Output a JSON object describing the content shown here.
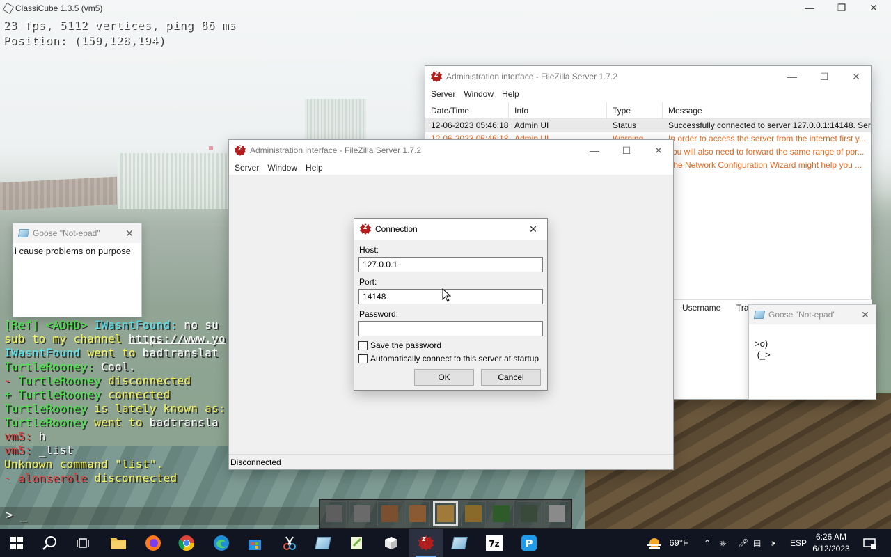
{
  "game": {
    "window_title": "ClassiCube 1.3.5 (vm5)",
    "hud_line1": "23 fps, 5112 vertices, ping 86 ms",
    "hud_line2": "Position: (159,128,194)",
    "chat": [
      [
        {
          "t": "[Ref] <ADHD> ",
          "c": "green"
        },
        {
          "t": "IWasntFound: ",
          "c": "cyan"
        },
        {
          "t": "no su",
          "c": "white"
        }
      ],
      [
        {
          "t": "sub to my channel ",
          "c": "yellow"
        },
        {
          "t": "https://www.yo",
          "c": "link"
        }
      ],
      [
        {
          "t": "IWasntFound",
          "c": "cyan"
        },
        {
          "t": " went to ",
          "c": "yellow"
        },
        {
          "t": "badtranslat",
          "c": "white"
        }
      ],
      [
        {
          "t": "TurtleRooney: ",
          "c": "green"
        },
        {
          "t": "Cool.",
          "c": "white"
        }
      ],
      [
        {
          "t": "- ",
          "c": "red"
        },
        {
          "t": "TurtleRooney",
          "c": "green"
        },
        {
          "t": " disconnected",
          "c": "yellow"
        }
      ],
      [
        {
          "t": "+ ",
          "c": "green"
        },
        {
          "t": "TurtleRooney",
          "c": "green"
        },
        {
          "t": " connected",
          "c": "yellow"
        }
      ],
      [
        {
          "t": "TurtleRooney",
          "c": "green"
        },
        {
          "t": " is lately known as:",
          "c": "yellow"
        }
      ],
      [
        {
          "t": "TurtleRooney",
          "c": "green"
        },
        {
          "t": " went to ",
          "c": "yellow"
        },
        {
          "t": "badtransla",
          "c": "white"
        }
      ],
      [
        {
          "t": "vm5: ",
          "c": "red"
        },
        {
          "t": "h",
          "c": "white"
        }
      ],
      [
        {
          "t": "vm5: ",
          "c": "red"
        },
        {
          "t": "_list",
          "c": "white"
        }
      ],
      [
        {
          "t": "Unknown command \"list\".",
          "c": "yellow"
        }
      ],
      [
        {
          "t": "- ",
          "c": "red"
        },
        {
          "t": "alonserole",
          "c": "red"
        },
        {
          "t": " disconnected",
          "c": "yellow"
        }
      ]
    ],
    "chat_input": "> _",
    "hotbar": [
      "#5e5e5e",
      "#6a6a6a",
      "#7a5030",
      "#8a5a34",
      "#a07a3a",
      "#8a6a2a",
      "#2f5a2a",
      "#3a4a3a",
      "#8a8a8a"
    ],
    "hotbar_selected": 4
  },
  "fz_back": {
    "title": "Administration interface - FileZilla Server 1.7.2",
    "menu": [
      "Server",
      "Window",
      "Help"
    ],
    "columns": [
      "Date/Time",
      "Info",
      "Type",
      "Message"
    ],
    "rows": [
      {
        "dt": "12-06-2023 05:46:18",
        "info": "Admin UI",
        "type": "Status",
        "msg": "Successfully connected to server 127.0.0.1:14148. Ser...",
        "kind": "status"
      },
      {
        "dt": "12-06-2023 05:46:18",
        "info": "Admin UI",
        "type": "Warning",
        "msg": "In order to access the server from the internet first y...",
        "kind": "warn"
      },
      {
        "dt": "",
        "info": "",
        "type": "",
        "msg": "you will also need to forward the same range of por...",
        "kind": "warn"
      },
      {
        "dt": "",
        "info": "",
        "type": "",
        "msg": "The Network Configuration Wizard might help you ...",
        "kind": "warn"
      }
    ],
    "lower_columns": [
      "Username",
      "Tra"
    ]
  },
  "fz_mid": {
    "title": "Administration interface - FileZilla Server 1.7.2",
    "menu": [
      "Server",
      "Window",
      "Help"
    ],
    "status": "Disconnected"
  },
  "dialog": {
    "title": "Connection",
    "host_label": "Host:",
    "host_value": "127.0.0.1",
    "port_label": "Port:",
    "port_value": "14148",
    "password_label": "Password:",
    "password_value": "",
    "save_password": "Save the password",
    "auto_connect": "Automatically connect to this server at startup",
    "ok": "OK",
    "cancel": "Cancel"
  },
  "goose1": {
    "title": "Goose \"Not-epad\"",
    "text": "i cause problems on purpose"
  },
  "goose2": {
    "title": "Goose \"Not-epad\"",
    "line1": ">o)",
    "line2": " (_>"
  },
  "taskbar": {
    "weather": "69°F",
    "lang": "ESP",
    "time": "6:26 AM",
    "date": "6/12/2023"
  }
}
